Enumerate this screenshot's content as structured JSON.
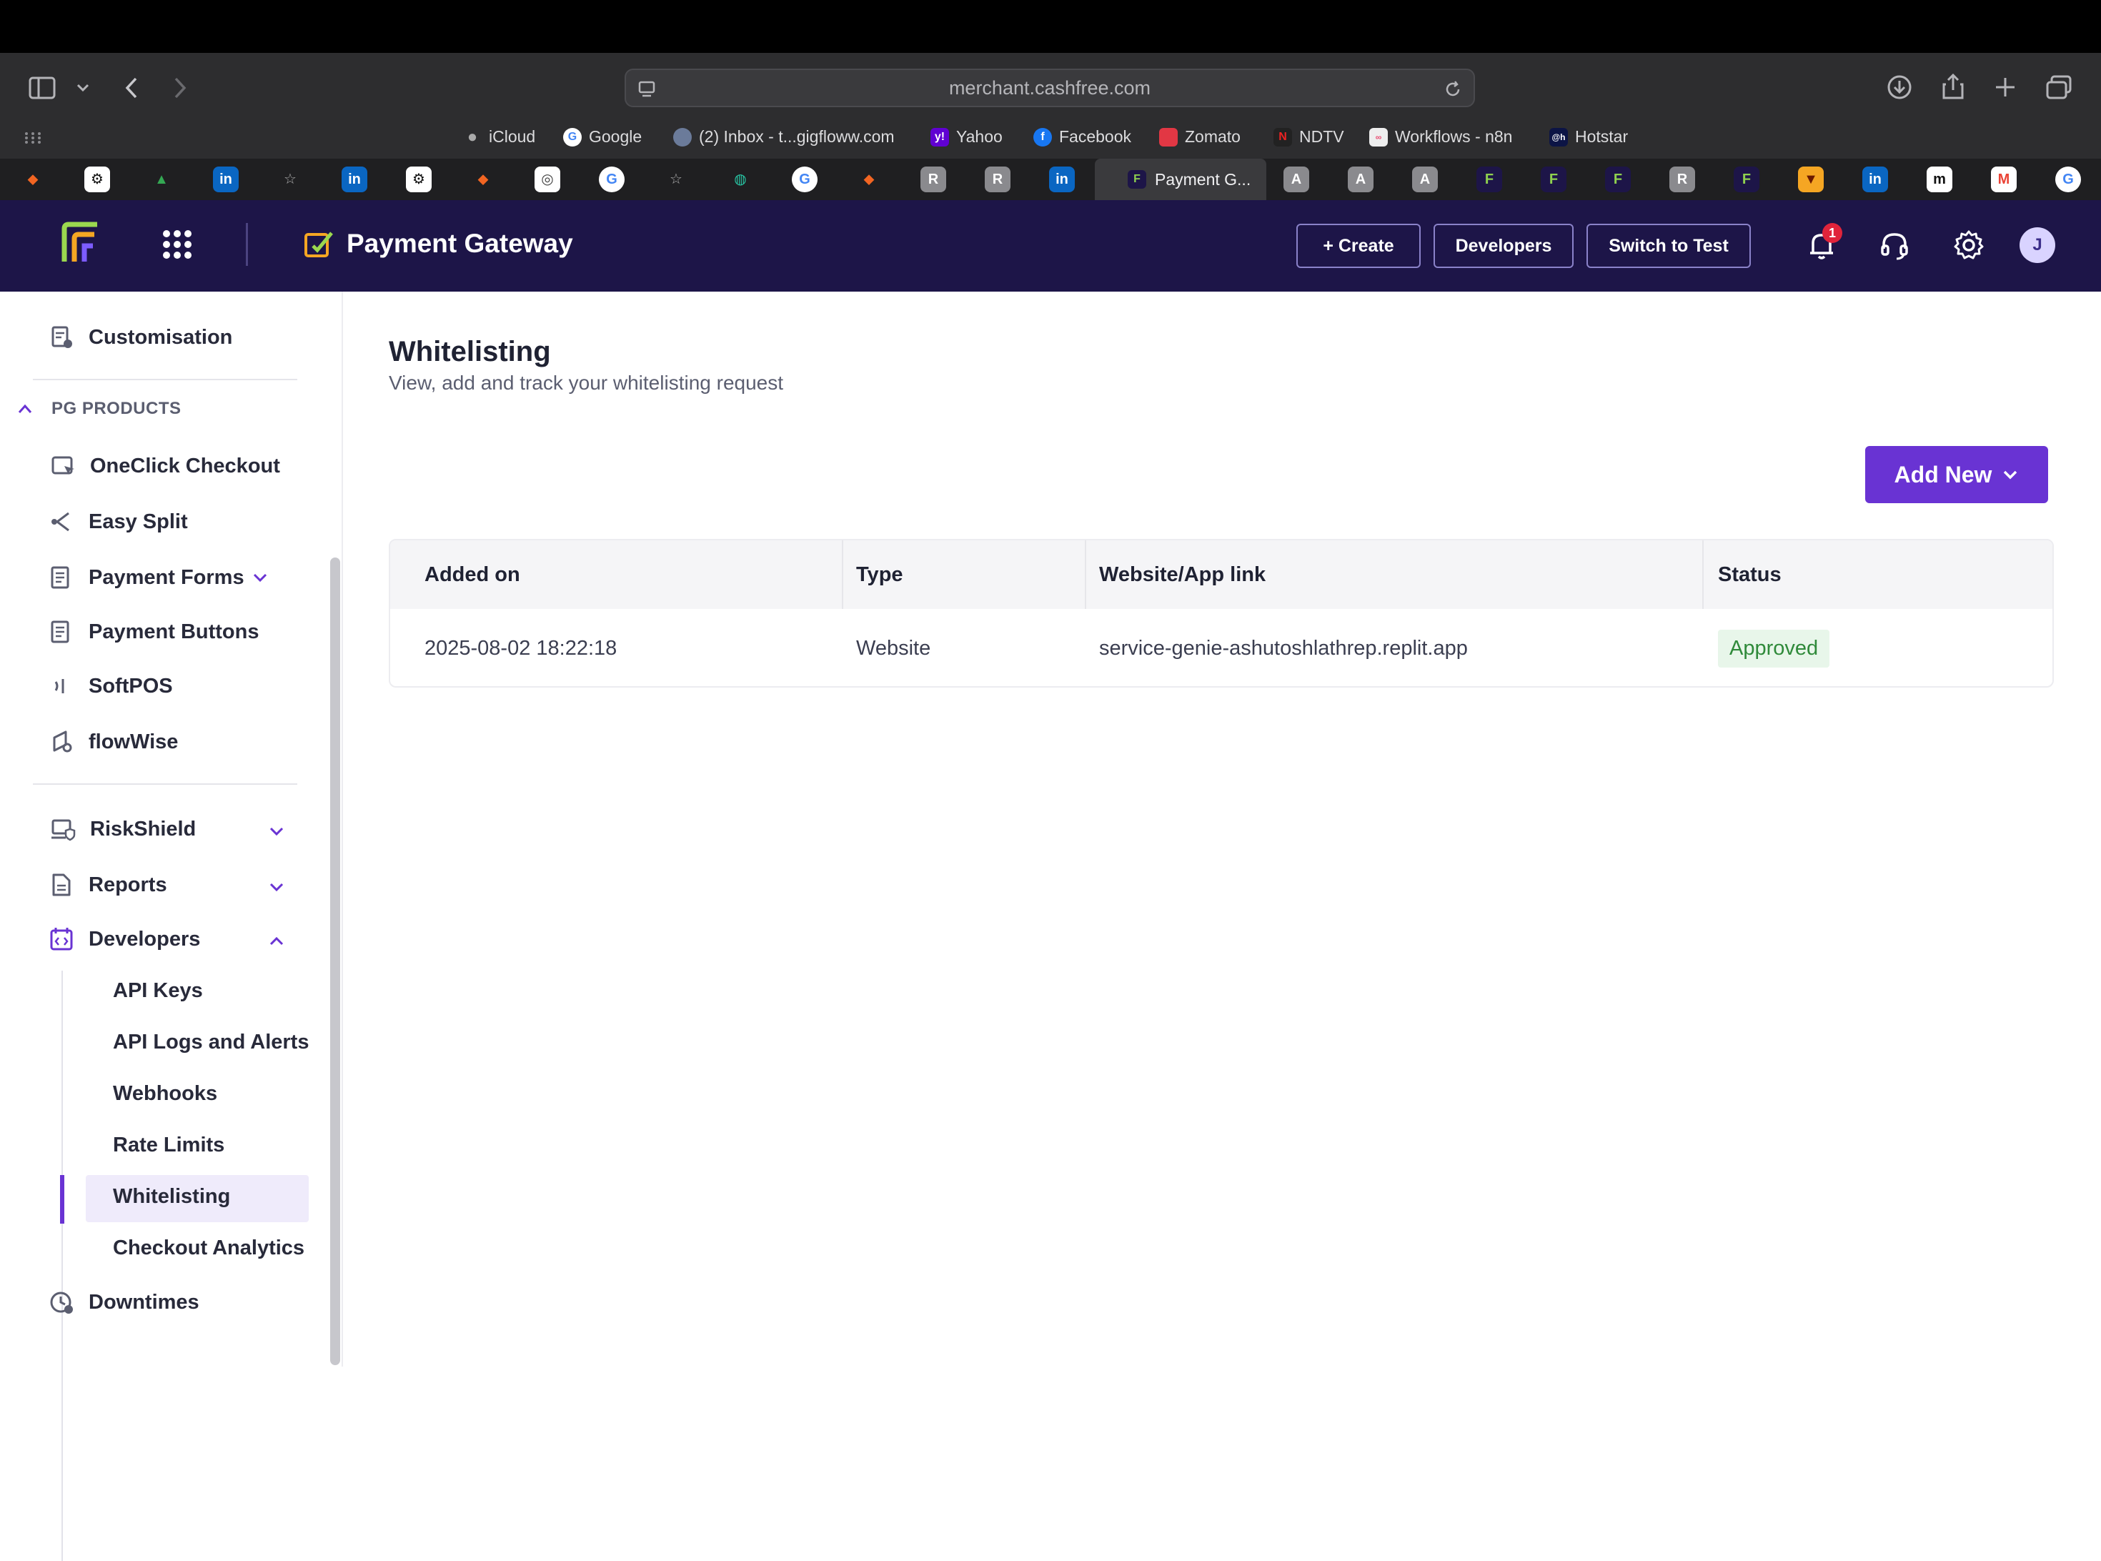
{
  "browser": {
    "url": "merchant.cashfree.com",
    "bookmarks": [
      "iCloud",
      "Google",
      "(2) Inbox - t...gigfloww.com",
      "Yahoo",
      "Facebook",
      "Zomato",
      "NDTV",
      "Workflows - n8n",
      "Hotstar"
    ],
    "active_tab_title": "Payment G..."
  },
  "header": {
    "title": "Payment Gateway",
    "create_label": "+ Create",
    "developers_label": "Developers",
    "switch_label": "Switch to Test",
    "notification_count": "1",
    "avatar_initial": "J"
  },
  "sidebar": {
    "customisation": "Customisation",
    "section_label": "PG PRODUCTS",
    "products": [
      "OneClick Checkout",
      "Easy Split",
      "Payment Forms",
      "Payment Buttons",
      "SoftPOS",
      "flowWise"
    ],
    "riskshield": "RiskShield",
    "reports": "Reports",
    "developers": "Developers",
    "dev_items": [
      "API Keys",
      "API Logs and Alerts",
      "Webhooks",
      "Rate Limits",
      "Whitelisting",
      "Checkout Analytics"
    ],
    "downtimes": "Downtimes"
  },
  "main": {
    "title": "Whitelisting",
    "subtitle": "View, add and track your whitelisting request",
    "add_new_label": "Add New",
    "columns": [
      "Added on",
      "Type",
      "Website/App link",
      "Status"
    ],
    "rows": [
      {
        "added_on": "2025-08-02 18:22:18",
        "type": "Website",
        "link": "service-genie-ashutoshlathrep.replit.app",
        "status": "Approved"
      }
    ]
  },
  "colors": {
    "brand_dark": "#1d1548",
    "accent": "#6933d3",
    "approved_bg": "#e8f6ea",
    "approved_text": "#2f8a3a"
  }
}
